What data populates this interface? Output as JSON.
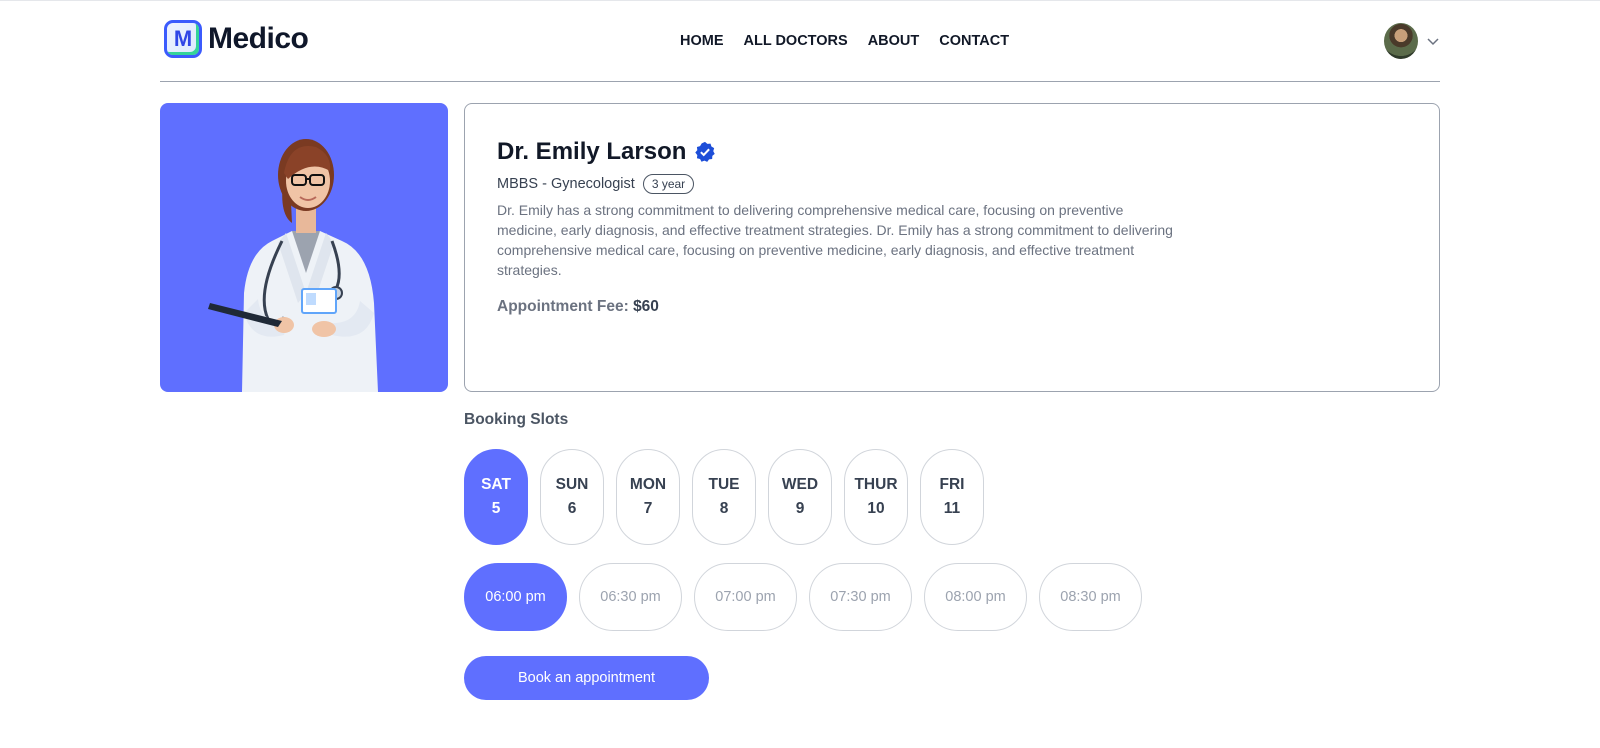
{
  "brand": {
    "name": "Medico",
    "mark": "M"
  },
  "nav": {
    "items": [
      "HOME",
      "ALL DOCTORS",
      "ABOUT",
      "CONTACT"
    ]
  },
  "doctor": {
    "name": "Dr. Emily Larson",
    "degree_specialty": "MBBS - Gynecologist",
    "experience": "3 year",
    "about": "Dr. Emily has a strong commitment to delivering comprehensive medical care, focusing on preventive medicine, early diagnosis, and effective treatment strategies. Dr. Emily has a strong commitment to delivering comprehensive medical care, focusing on preventive medicine, early diagnosis, and effective treatment strategies.",
    "fee_label": "Appointment Fee:",
    "fee_value": "$60"
  },
  "booking": {
    "title": "Booking Slots",
    "days": [
      {
        "day": "SAT",
        "date": "5"
      },
      {
        "day": "SUN",
        "date": "6"
      },
      {
        "day": "MON",
        "date": "7"
      },
      {
        "day": "TUE",
        "date": "8"
      },
      {
        "day": "WED",
        "date": "9"
      },
      {
        "day": "THUR",
        "date": "10"
      },
      {
        "day": "FRI",
        "date": "11"
      }
    ],
    "times": [
      "06:00 pm",
      "06:30 pm",
      "07:00 pm",
      "07:30 pm",
      "08:00 pm",
      "08:30 pm"
    ],
    "selected_day_index": 0,
    "selected_time_index": 0,
    "book_label": "Book an appointment"
  },
  "colors": {
    "primary": "#5f6fff",
    "verified": "#1d4ed8"
  },
  "icons": {
    "verified": "verified-badge-icon",
    "profile_chevron": "chevron-down-icon"
  }
}
